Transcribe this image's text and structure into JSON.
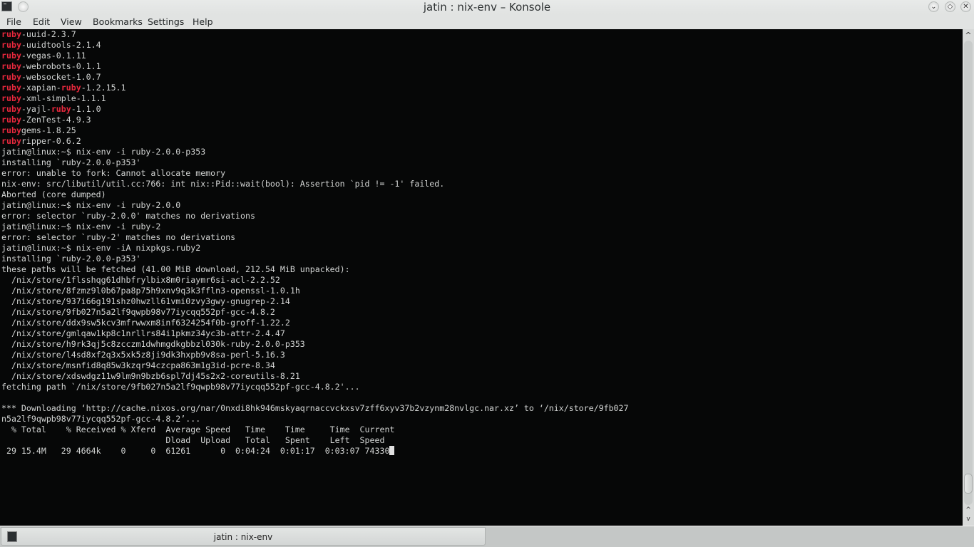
{
  "window": {
    "title": "jatin : nix-env – Konsole"
  },
  "menu": [
    "File",
    "Edit",
    "View",
    "Bookmarks",
    "Settings",
    "Help"
  ],
  "colors": {
    "background": "#060707",
    "text": "#d2d4d3",
    "highlight": "#e8283d"
  },
  "terminal": {
    "lines": [
      [
        [
          "ruby",
          1
        ],
        [
          "-uuid-2.3.7",
          0
        ]
      ],
      [
        [
          "ruby",
          1
        ],
        [
          "-uuidtools-2.1.4",
          0
        ]
      ],
      [
        [
          "ruby",
          1
        ],
        [
          "-vegas-0.1.11",
          0
        ]
      ],
      [
        [
          "ruby",
          1
        ],
        [
          "-webrobots-0.1.1",
          0
        ]
      ],
      [
        [
          "ruby",
          1
        ],
        [
          "-websocket-1.0.7",
          0
        ]
      ],
      [
        [
          "ruby",
          1
        ],
        [
          "-xapian-",
          0
        ],
        [
          "ruby",
          1
        ],
        [
          "-1.2.15.1",
          0
        ]
      ],
      [
        [
          "ruby",
          1
        ],
        [
          "-xml-simple-1.1.1",
          0
        ]
      ],
      [
        [
          "ruby",
          1
        ],
        [
          "-yajl-",
          0
        ],
        [
          "ruby",
          1
        ],
        [
          "-1.1.0",
          0
        ]
      ],
      [
        [
          "ruby",
          1
        ],
        [
          "-ZenTest-4.9.3",
          0
        ]
      ],
      [
        [
          "ruby",
          1
        ],
        [
          "gems-1.8.25",
          0
        ]
      ],
      [
        [
          "ruby",
          1
        ],
        [
          "ripper-0.6.2",
          0
        ]
      ],
      [
        [
          "jatin@linux:~$ nix-env -i ruby-2.0.0-p353",
          0
        ]
      ],
      [
        [
          "installing `ruby-2.0.0-p353'",
          0
        ]
      ],
      [
        [
          "error: unable to fork: Cannot allocate memory",
          0
        ]
      ],
      [
        [
          "nix-env: src/libutil/util.cc:766: int nix::Pid::wait(bool): Assertion `pid != -1' failed.",
          0
        ]
      ],
      [
        [
          "Aborted (core dumped)",
          0
        ]
      ],
      [
        [
          "jatin@linux:~$ nix-env -i ruby-2.0.0",
          0
        ]
      ],
      [
        [
          "error: selector `ruby-2.0.0' matches no derivations",
          0
        ]
      ],
      [
        [
          "jatin@linux:~$ nix-env -i ruby-2",
          0
        ]
      ],
      [
        [
          "error: selector `ruby-2' matches no derivations",
          0
        ]
      ],
      [
        [
          "jatin@linux:~$ nix-env -iA nixpkgs.ruby2",
          0
        ]
      ],
      [
        [
          "installing `ruby-2.0.0-p353'",
          0
        ]
      ],
      [
        [
          "these paths will be fetched (41.00 MiB download, 212.54 MiB unpacked):",
          0
        ]
      ],
      [
        [
          "  /nix/store/1flsshqg61dhbfrylbix8m0riaymr6si-acl-2.2.52",
          0
        ]
      ],
      [
        [
          "  /nix/store/8fzmz9l0b67pa8p75h9xnv9q3k3ffln3-openssl-1.0.1h",
          0
        ]
      ],
      [
        [
          "  /nix/store/937i66g191shz0hwzll61vmi0zvy3gwy-gnugrep-2.14",
          0
        ]
      ],
      [
        [
          "  /nix/store/9fb027n5a2lf9qwpb98v77iycqq552pf-gcc-4.8.2",
          0
        ]
      ],
      [
        [
          "  /nix/store/ddx9sw5kcv3mfrwwxm8inf6324254f0b-groff-1.22.2",
          0
        ]
      ],
      [
        [
          "  /nix/store/gmlqaw1kp8c1nrllrs84i1pkmz34yc3b-attr-2.4.47",
          0
        ]
      ],
      [
        [
          "  /nix/store/h9rk3qj5c8zcczm1dwhmgdkgbbzl030k-ruby-2.0.0-p353",
          0
        ]
      ],
      [
        [
          "  /nix/store/l4sd8xf2q3x5xk5z8ji9dk3hxpb9v8sa-perl-5.16.3",
          0
        ]
      ],
      [
        [
          "  /nix/store/msnfid8q85w3kzqr94czcpa863m1g3id-pcre-8.34",
          0
        ]
      ],
      [
        [
          "  /nix/store/xdswdgz11w9lm9n9bzb6spl7dj45s2x2-coreutils-8.21",
          0
        ]
      ],
      [
        [
          "fetching path `/nix/store/9fb027n5a2lf9qwpb98v77iycqq552pf-gcc-4.8.2'...",
          0
        ]
      ],
      [],
      [
        [
          "*** Downloading ‘http://cache.nixos.org/nar/0nxdi8hk946mskyaqrnaccvckxsv7zff6xyv37b2vzynm28nvlgc.nar.xz’ to ‘/nix/store/9fb027",
          0
        ]
      ],
      [
        [
          "n5a2lf9qwpb98v77iycqq552pf-gcc-4.8.2’...",
          0
        ]
      ],
      [
        [
          "  % Total    % Received % Xferd  Average Speed   Time    Time     Time  Current",
          0
        ]
      ],
      [
        [
          "                                 Dload  Upload   Total   Spent    Left  Speed",
          0
        ]
      ],
      [
        [
          " 29 15.4M   29 4664k    0     0  61261      0  0:04:24  0:01:17  0:03:07 74330",
          0
        ]
      ]
    ]
  },
  "tabs": [
    {
      "label": "jatin : nix-env"
    }
  ]
}
